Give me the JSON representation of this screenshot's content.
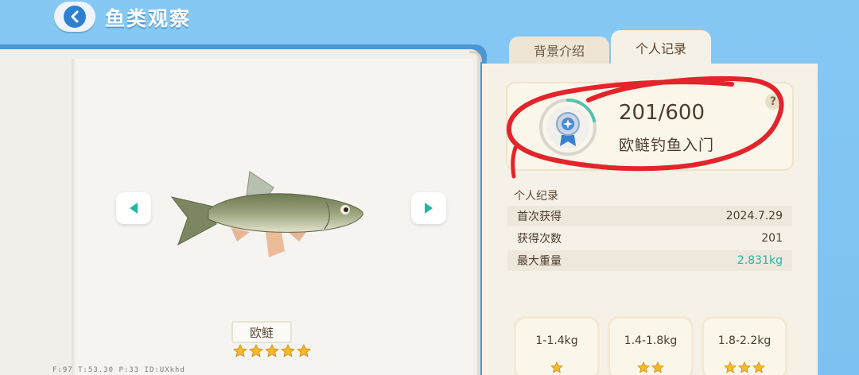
{
  "header": {
    "title": "鱼类观察"
  },
  "tabs": [
    {
      "label": "背景介绍",
      "active": false
    },
    {
      "label": "个人记录",
      "active": true
    }
  ],
  "fish": {
    "name": "欧鲢",
    "stars": 5
  },
  "achievement": {
    "count": "201/600",
    "title": "欧鲢钓鱼入门",
    "progress": 0.335
  },
  "records": {
    "section_title": "个人纪录",
    "rows": [
      {
        "label": "首次获得",
        "value": "2024.7.29"
      },
      {
        "label": "获得次数",
        "value": "201"
      },
      {
        "label": "最大重量",
        "value": "2.831kg"
      }
    ]
  },
  "weight_tiers": [
    {
      "label": "1-1.4kg",
      "stars": 1
    },
    {
      "label": "1.4-1.8kg",
      "stars": 2
    },
    {
      "label": "1.8-2.2kg",
      "stars": 3
    }
  ],
  "footer_text": "F:97 T:53.30 P:33 ID:UXkhd",
  "colors": {
    "accent_teal": "#1fb6a6",
    "star": "#f5b82e",
    "annotation_red": "#e3242b"
  },
  "icons": {
    "back": "chevron-left-icon",
    "prev": "triangle-left-icon",
    "next": "triangle-right-icon",
    "help": "question-icon",
    "medal": "medal-icon"
  }
}
